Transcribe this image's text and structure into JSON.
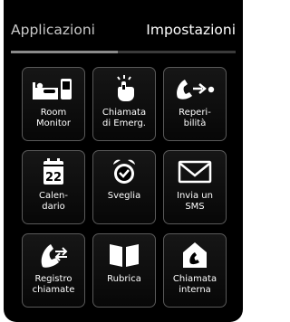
{
  "tabs": {
    "applications": "Applicazioni",
    "settings": "Impostazioni"
  },
  "tiles": [
    {
      "label": "Room\nMonitor",
      "icon": "baby-monitor-icon"
    },
    {
      "label": "Chiamata\ndi Emerg.",
      "icon": "emergency-call-icon"
    },
    {
      "label": "Reperi-\nbilità",
      "icon": "reachability-icon"
    },
    {
      "label": "Calen-\ndario",
      "icon": "calendar-icon",
      "icon_text": "22"
    },
    {
      "label": "Sveglia",
      "icon": "alarm-clock-icon"
    },
    {
      "label": "Invia un\nSMS",
      "icon": "envelope-icon"
    },
    {
      "label": "Registro\nchiamate",
      "icon": "call-log-icon"
    },
    {
      "label": "Rubrica",
      "icon": "phonebook-icon"
    },
    {
      "label": "Chiamata\ninterna",
      "icon": "internal-call-icon"
    }
  ]
}
